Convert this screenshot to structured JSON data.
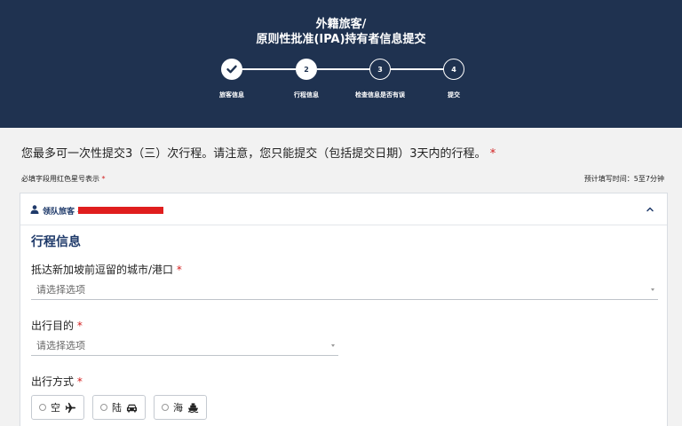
{
  "header": {
    "title_line1": "外籍旅客/",
    "title_line2": "原则性批准(IPA)持有者信息提交",
    "steps": [
      {
        "number": "",
        "label": "旅客信息",
        "state": "done"
      },
      {
        "number": "2",
        "label": "行程信息",
        "state": "active"
      },
      {
        "number": "3",
        "label": "检查信息是否有误",
        "state": "todo"
      },
      {
        "number": "4",
        "label": "提交",
        "state": "todo"
      }
    ]
  },
  "notice": {
    "text": "您最多可一次性提交3（三）次行程。请注意，您只能提交（包括提交日期）3天内的行程。",
    "asterisk": "*"
  },
  "required_note": {
    "text": "必填字段用红色星号表示",
    "asterisk": "*"
  },
  "estimated_time": "预计填写时间：5至7分钟",
  "card": {
    "traveller_label": "领队旅客 -",
    "section_title": "行程信息",
    "fields": {
      "city_label": "抵达新加坡前逗留的城市/港口",
      "city_placeholder": "请选择选项",
      "purpose_label": "出行目的",
      "purpose_placeholder": "请选择选项",
      "mode_label": "出行方式",
      "required_mark": "*"
    },
    "modes": [
      {
        "label": "空",
        "icon": "airplane-icon"
      },
      {
        "label": "陆",
        "icon": "car-icon"
      },
      {
        "label": "海",
        "icon": "ship-icon"
      }
    ]
  },
  "colors": {
    "header_bg": "#1f3250",
    "accent_text": "#1f3a6a",
    "required_red": "#d21f1f"
  }
}
